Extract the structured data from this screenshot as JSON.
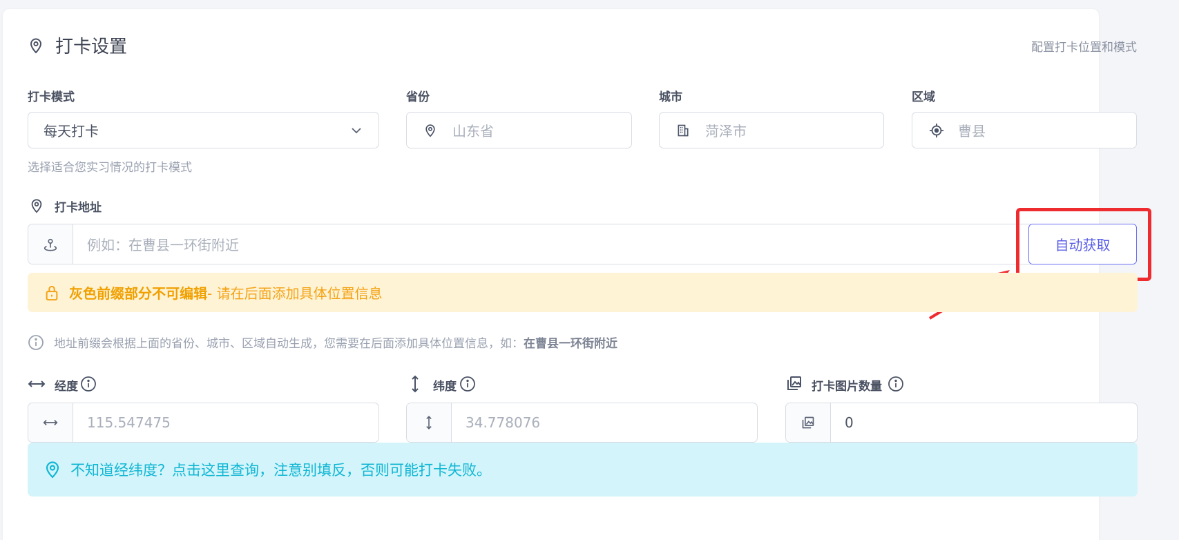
{
  "header": {
    "title": "打卡设置",
    "subtitle": "配置打卡位置和模式",
    "icon": "map-pin-icon"
  },
  "mode": {
    "label": "打卡模式",
    "value": "每天打卡",
    "help": "选择适合您实习情况的打卡模式"
  },
  "province": {
    "label": "省份",
    "placeholder": "山东省"
  },
  "city": {
    "label": "城市",
    "placeholder": "菏泽市"
  },
  "district": {
    "label": "区域",
    "placeholder": "曹县"
  },
  "address": {
    "label": "打卡地址",
    "placeholder": "例如：在曹县一环街附近",
    "auto_button": "自动获取",
    "warning_bold": "灰色前缀部分不可编辑",
    "warning_rest": " - 请在后面添加具体位置信息",
    "note_text": "地址前缀会根据上面的省份、城市、区域自动生成，您需要在后面添加具体位置信息，如：",
    "note_example": "在曹县一环街附近"
  },
  "longitude": {
    "label": "经度",
    "placeholder": "115.547475"
  },
  "latitude": {
    "label": "纬度",
    "placeholder": "34.778076"
  },
  "image_count": {
    "label": "打卡图片数量",
    "value": "0"
  },
  "coords_help": "不知道经纬度？点击这里查询，注意别填反，否则可能打卡失败。",
  "colors": {
    "accent": "#5b5fe6",
    "warning": "#f3a316",
    "info": "#10b6d4",
    "annotation": "#ee2b2f"
  }
}
